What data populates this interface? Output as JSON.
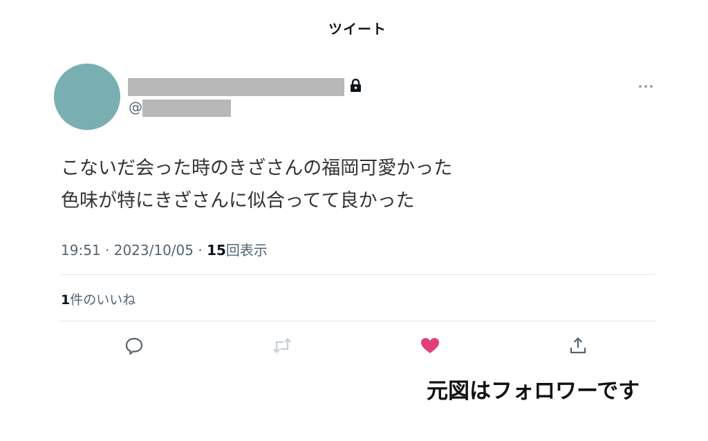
{
  "header": {
    "title": "ツイート"
  },
  "author": {
    "handle_prefix": "@",
    "avatar_color": "#7aafb1",
    "redaction_color": "#b8b8b8",
    "lock_icon": "lock-icon",
    "more_icon": "more-options-icon"
  },
  "tweet": {
    "lines": [
      "こないだ会った時のきざさんの福岡可愛かった",
      "色味が特にきざさんに似合ってて良かった"
    ]
  },
  "meta": {
    "time": "19:51",
    "separator": "·",
    "date": "2023/10/05",
    "views_count": "15",
    "views_label": "回表示"
  },
  "likes": {
    "count": "1",
    "label": "件のいいね"
  },
  "actions": [
    {
      "name": "reply",
      "icon": "reply-icon",
      "color": "#536471"
    },
    {
      "name": "retweet",
      "icon": "retweet-icon",
      "color": "#c4cfd6"
    },
    {
      "name": "like",
      "icon": "heart-icon",
      "color": "#e0407a"
    },
    {
      "name": "share",
      "icon": "share-icon",
      "color": "#536471"
    }
  ],
  "caption": {
    "text": "元図はフォロワーです"
  }
}
